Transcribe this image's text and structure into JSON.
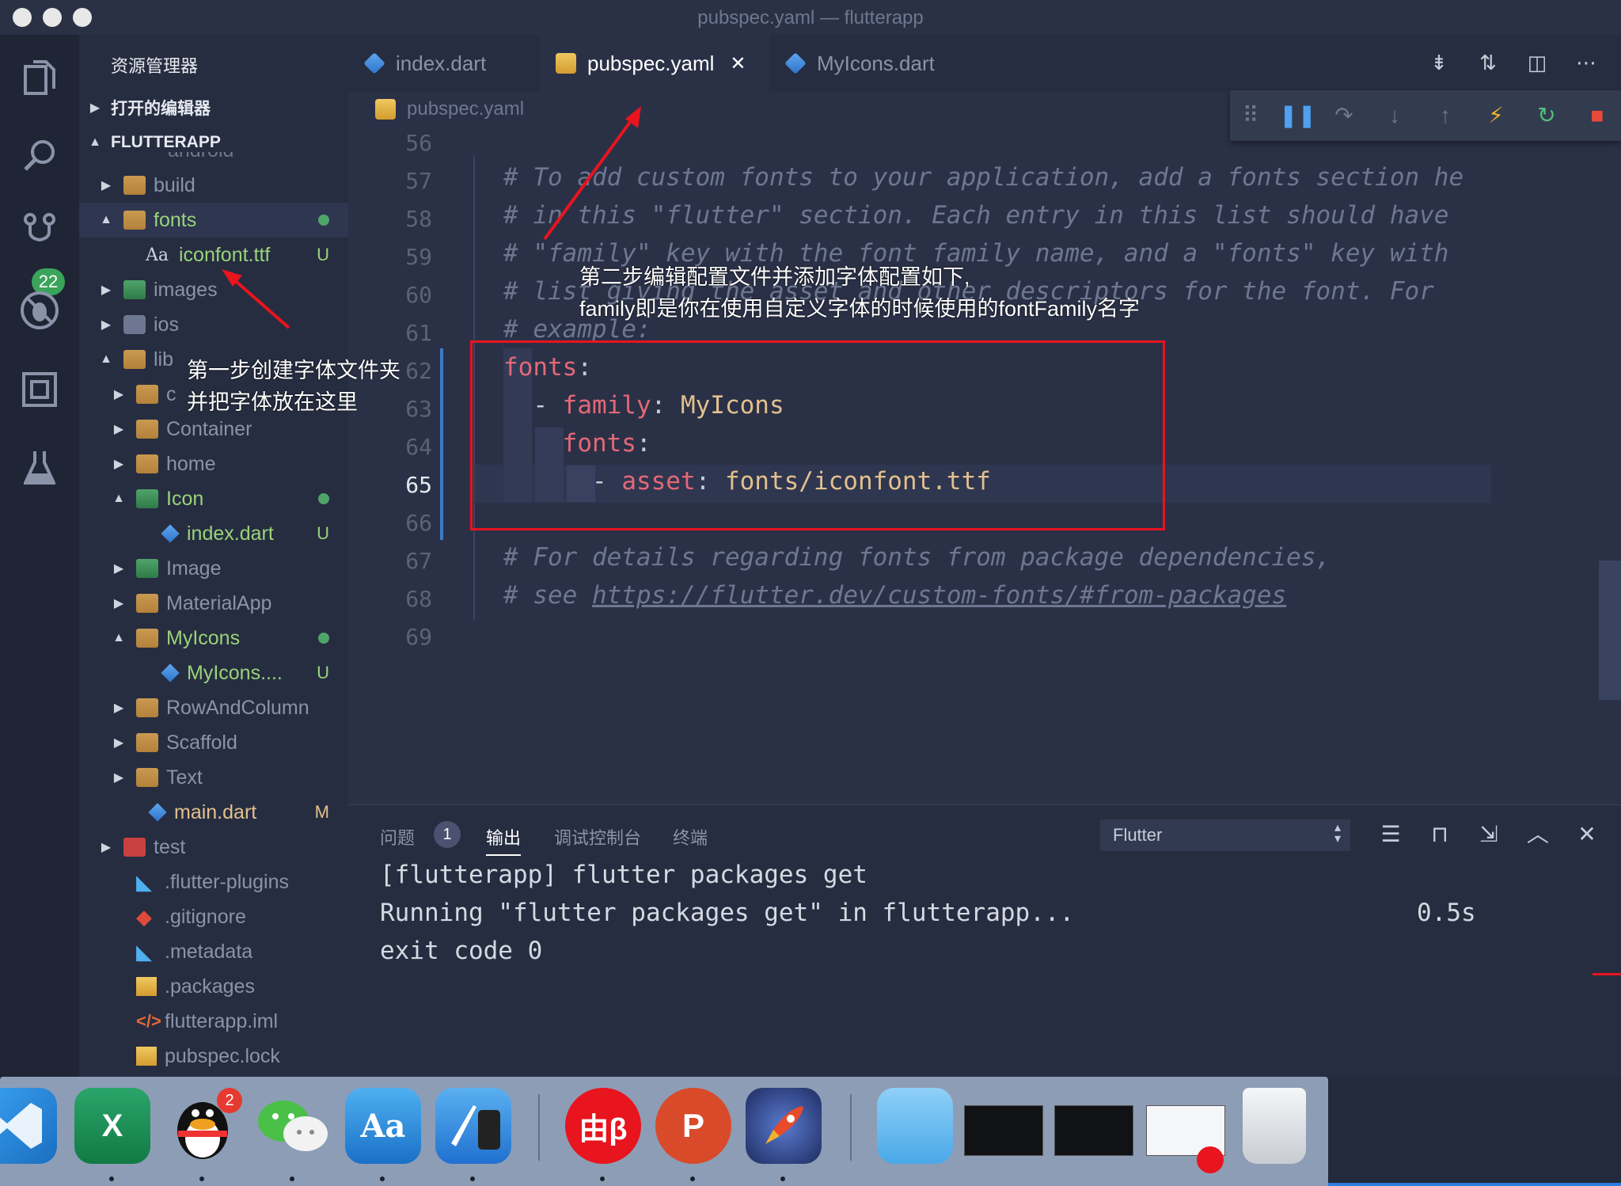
{
  "window": {
    "title": "pubspec.yaml — flutterapp"
  },
  "activity": {
    "scm_badge": "22"
  },
  "sidebar": {
    "title": "资源管理器",
    "open_editors": "打开的编辑器",
    "project": "FLUTTERAPP",
    "partial_item": "android",
    "items": [
      {
        "label": "build",
        "status": ""
      },
      {
        "label": "fonts",
        "status": ""
      },
      {
        "label": "iconfont.ttf",
        "status": "U",
        "file_glyph": "Aa"
      },
      {
        "label": "images",
        "status": ""
      },
      {
        "label": "ios",
        "status": ""
      },
      {
        "label": "lib",
        "status": ""
      },
      {
        "label": "c",
        "status": ""
      },
      {
        "label": "Container",
        "status": ""
      },
      {
        "label": "home",
        "status": ""
      },
      {
        "label": "Icon",
        "status": ""
      },
      {
        "label": "index.dart",
        "status": "U"
      },
      {
        "label": "Image",
        "status": ""
      },
      {
        "label": "MaterialApp",
        "status": ""
      },
      {
        "label": "MyIcons",
        "status": ""
      },
      {
        "label": "MyIcons....",
        "status": "U"
      },
      {
        "label": "RowAndColumn",
        "status": ""
      },
      {
        "label": "Scaffold",
        "status": ""
      },
      {
        "label": "Text",
        "status": ""
      },
      {
        "label": "main.dart",
        "status": "M"
      },
      {
        "label": "test",
        "status": ""
      },
      {
        "label": ".flutter-plugins",
        "status": ""
      },
      {
        "label": ".gitignore",
        "status": ""
      },
      {
        "label": ".metadata",
        "status": ""
      },
      {
        "label": ".packages",
        "status": ""
      },
      {
        "label": "flutterapp.iml",
        "status": ""
      },
      {
        "label": "pubspec.lock",
        "status": ""
      }
    ]
  },
  "tabs": [
    {
      "label": "index.dart"
    },
    {
      "label": "pubspec.yaml",
      "close": "✕"
    },
    {
      "label": "MyIcons.dart"
    }
  ],
  "breadcrumb": "pubspec.yaml",
  "editor": {
    "line_numbers": [
      "56",
      "57",
      "58",
      "59",
      "60",
      "61",
      "62",
      "63",
      "64",
      "65",
      "66",
      "67",
      "68",
      "69"
    ],
    "current_line": "65",
    "lines": {
      "l57": "# To add custom fonts to your application, add a fonts section he",
      "l58": "# in this \"flutter\" section. Each entry in this list should have",
      "l59": "# \"family\" key with the font family name, and a \"fonts\" key with",
      "l60": "# list giving the asset and other descriptors for the font. For",
      "l61": "# example:",
      "l62_key": "fonts",
      "l63_key": "family",
      "l63_val": "MyIcons",
      "l64_key": "fonts",
      "l65_key": "asset",
      "l65_val": "fonts/iconfont.ttf",
      "l67": "# For details regarding fonts from package dependencies,",
      "l68_prefix": "# see ",
      "l68_url": "https://flutter.dev/custom-fonts/#from-packages"
    }
  },
  "annotations": {
    "step1_line1": "第一步创建字体文件夹",
    "step1_line2": "并把字体放在这里",
    "step2_line1": "第二步编辑配置文件并添加字体配置如下,",
    "step2_line2": "family即是你在使用自定义字体的时候使用的fontFamily名字"
  },
  "panel": {
    "tabs": [
      "问题",
      "输出",
      "调试控制台",
      "终端"
    ],
    "problems_count": "1",
    "output_channel": "Flutter",
    "output": [
      "[flutterapp] flutter packages get",
      "Running \"flutter packages get\" in flutterapp...",
      "exit code 0"
    ],
    "duration": "0.5s"
  },
  "dock": {
    "qq_badge": "2",
    "excel_letter": "X",
    "ppt_letter": "P",
    "youdao_text": "由β"
  },
  "colors": {
    "accent_green": "#3aa45a",
    "annotation_red": "#e8141e",
    "editor_bg": "#2a3147"
  }
}
